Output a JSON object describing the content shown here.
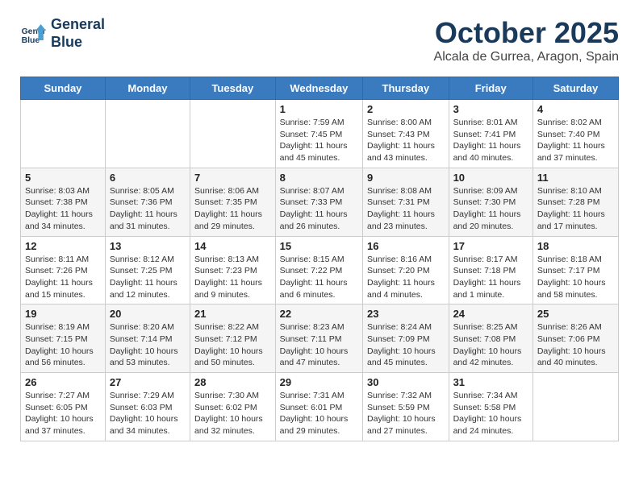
{
  "logo": {
    "line1": "General",
    "line2": "Blue"
  },
  "header": {
    "month": "October 2025",
    "location": "Alcala de Gurrea, Aragon, Spain"
  },
  "weekdays": [
    "Sunday",
    "Monday",
    "Tuesday",
    "Wednesday",
    "Thursday",
    "Friday",
    "Saturday"
  ],
  "weeks": [
    [
      {
        "day": "",
        "sunrise": "",
        "sunset": "",
        "daylight": ""
      },
      {
        "day": "",
        "sunrise": "",
        "sunset": "",
        "daylight": ""
      },
      {
        "day": "",
        "sunrise": "",
        "sunset": "",
        "daylight": ""
      },
      {
        "day": "1",
        "sunrise": "Sunrise: 7:59 AM",
        "sunset": "Sunset: 7:45 PM",
        "daylight": "Daylight: 11 hours and 45 minutes."
      },
      {
        "day": "2",
        "sunrise": "Sunrise: 8:00 AM",
        "sunset": "Sunset: 7:43 PM",
        "daylight": "Daylight: 11 hours and 43 minutes."
      },
      {
        "day": "3",
        "sunrise": "Sunrise: 8:01 AM",
        "sunset": "Sunset: 7:41 PM",
        "daylight": "Daylight: 11 hours and 40 minutes."
      },
      {
        "day": "4",
        "sunrise": "Sunrise: 8:02 AM",
        "sunset": "Sunset: 7:40 PM",
        "daylight": "Daylight: 11 hours and 37 minutes."
      }
    ],
    [
      {
        "day": "5",
        "sunrise": "Sunrise: 8:03 AM",
        "sunset": "Sunset: 7:38 PM",
        "daylight": "Daylight: 11 hours and 34 minutes."
      },
      {
        "day": "6",
        "sunrise": "Sunrise: 8:05 AM",
        "sunset": "Sunset: 7:36 PM",
        "daylight": "Daylight: 11 hours and 31 minutes."
      },
      {
        "day": "7",
        "sunrise": "Sunrise: 8:06 AM",
        "sunset": "Sunset: 7:35 PM",
        "daylight": "Daylight: 11 hours and 29 minutes."
      },
      {
        "day": "8",
        "sunrise": "Sunrise: 8:07 AM",
        "sunset": "Sunset: 7:33 PM",
        "daylight": "Daylight: 11 hours and 26 minutes."
      },
      {
        "day": "9",
        "sunrise": "Sunrise: 8:08 AM",
        "sunset": "Sunset: 7:31 PM",
        "daylight": "Daylight: 11 hours and 23 minutes."
      },
      {
        "day": "10",
        "sunrise": "Sunrise: 8:09 AM",
        "sunset": "Sunset: 7:30 PM",
        "daylight": "Daylight: 11 hours and 20 minutes."
      },
      {
        "day": "11",
        "sunrise": "Sunrise: 8:10 AM",
        "sunset": "Sunset: 7:28 PM",
        "daylight": "Daylight: 11 hours and 17 minutes."
      }
    ],
    [
      {
        "day": "12",
        "sunrise": "Sunrise: 8:11 AM",
        "sunset": "Sunset: 7:26 PM",
        "daylight": "Daylight: 11 hours and 15 minutes."
      },
      {
        "day": "13",
        "sunrise": "Sunrise: 8:12 AM",
        "sunset": "Sunset: 7:25 PM",
        "daylight": "Daylight: 11 hours and 12 minutes."
      },
      {
        "day": "14",
        "sunrise": "Sunrise: 8:13 AM",
        "sunset": "Sunset: 7:23 PM",
        "daylight": "Daylight: 11 hours and 9 minutes."
      },
      {
        "day": "15",
        "sunrise": "Sunrise: 8:15 AM",
        "sunset": "Sunset: 7:22 PM",
        "daylight": "Daylight: 11 hours and 6 minutes."
      },
      {
        "day": "16",
        "sunrise": "Sunrise: 8:16 AM",
        "sunset": "Sunset: 7:20 PM",
        "daylight": "Daylight: 11 hours and 4 minutes."
      },
      {
        "day": "17",
        "sunrise": "Sunrise: 8:17 AM",
        "sunset": "Sunset: 7:18 PM",
        "daylight": "Daylight: 11 hours and 1 minute."
      },
      {
        "day": "18",
        "sunrise": "Sunrise: 8:18 AM",
        "sunset": "Sunset: 7:17 PM",
        "daylight": "Daylight: 10 hours and 58 minutes."
      }
    ],
    [
      {
        "day": "19",
        "sunrise": "Sunrise: 8:19 AM",
        "sunset": "Sunset: 7:15 PM",
        "daylight": "Daylight: 10 hours and 56 minutes."
      },
      {
        "day": "20",
        "sunrise": "Sunrise: 8:20 AM",
        "sunset": "Sunset: 7:14 PM",
        "daylight": "Daylight: 10 hours and 53 minutes."
      },
      {
        "day": "21",
        "sunrise": "Sunrise: 8:22 AM",
        "sunset": "Sunset: 7:12 PM",
        "daylight": "Daylight: 10 hours and 50 minutes."
      },
      {
        "day": "22",
        "sunrise": "Sunrise: 8:23 AM",
        "sunset": "Sunset: 7:11 PM",
        "daylight": "Daylight: 10 hours and 47 minutes."
      },
      {
        "day": "23",
        "sunrise": "Sunrise: 8:24 AM",
        "sunset": "Sunset: 7:09 PM",
        "daylight": "Daylight: 10 hours and 45 minutes."
      },
      {
        "day": "24",
        "sunrise": "Sunrise: 8:25 AM",
        "sunset": "Sunset: 7:08 PM",
        "daylight": "Daylight: 10 hours and 42 minutes."
      },
      {
        "day": "25",
        "sunrise": "Sunrise: 8:26 AM",
        "sunset": "Sunset: 7:06 PM",
        "daylight": "Daylight: 10 hours and 40 minutes."
      }
    ],
    [
      {
        "day": "26",
        "sunrise": "Sunrise: 7:27 AM",
        "sunset": "Sunset: 6:05 PM",
        "daylight": "Daylight: 10 hours and 37 minutes."
      },
      {
        "day": "27",
        "sunrise": "Sunrise: 7:29 AM",
        "sunset": "Sunset: 6:03 PM",
        "daylight": "Daylight: 10 hours and 34 minutes."
      },
      {
        "day": "28",
        "sunrise": "Sunrise: 7:30 AM",
        "sunset": "Sunset: 6:02 PM",
        "daylight": "Daylight: 10 hours and 32 minutes."
      },
      {
        "day": "29",
        "sunrise": "Sunrise: 7:31 AM",
        "sunset": "Sunset: 6:01 PM",
        "daylight": "Daylight: 10 hours and 29 minutes."
      },
      {
        "day": "30",
        "sunrise": "Sunrise: 7:32 AM",
        "sunset": "Sunset: 5:59 PM",
        "daylight": "Daylight: 10 hours and 27 minutes."
      },
      {
        "day": "31",
        "sunrise": "Sunrise: 7:34 AM",
        "sunset": "Sunset: 5:58 PM",
        "daylight": "Daylight: 10 hours and 24 minutes."
      },
      {
        "day": "",
        "sunrise": "",
        "sunset": "",
        "daylight": ""
      }
    ]
  ]
}
